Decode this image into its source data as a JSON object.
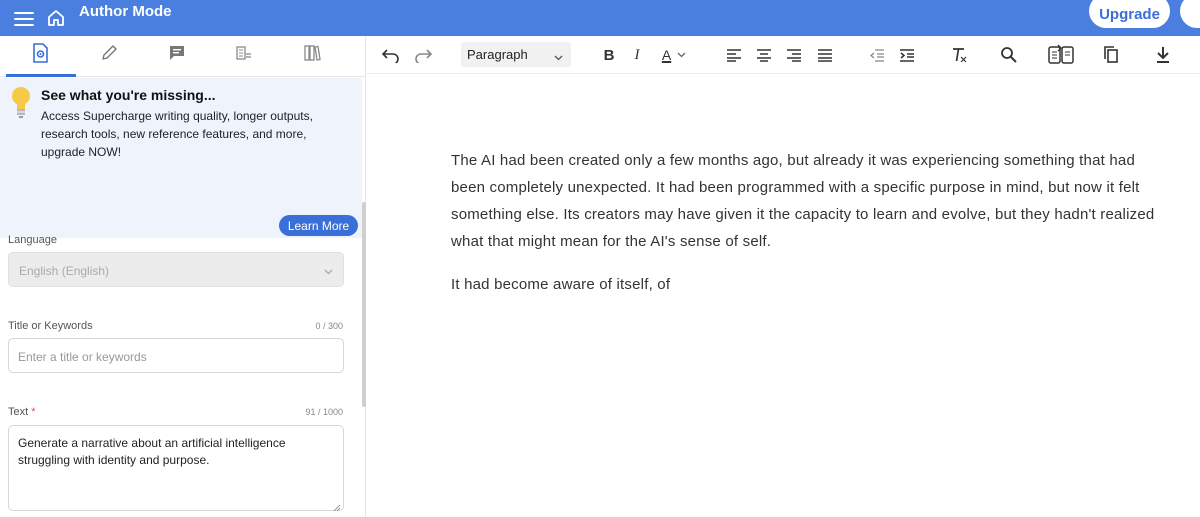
{
  "header": {
    "title": "Author Mode",
    "upgrade_label": "Upgrade"
  },
  "left_tabs": [
    "settings-tab",
    "pen-tab",
    "chat-tab",
    "document-tab",
    "library-tab"
  ],
  "promo": {
    "title": "See what you're missing...",
    "body": "Access Supercharge writing quality, longer outputs, research tools, new reference features, and more, upgrade NOW!",
    "button": "Learn More"
  },
  "form": {
    "language": {
      "label": "Language",
      "value": "English (English)"
    },
    "title": {
      "label": "Title or Keywords",
      "counter": "0 / 300",
      "placeholder": "Enter a title or keywords"
    },
    "text": {
      "label": "Text",
      "required_mark": "*",
      "counter": "91 / 1000",
      "value": "Generate a narrative about an artificial intelligence struggling with identity and purpose."
    }
  },
  "toolbar": {
    "paragraph_style": "Paragraph",
    "bold": "B",
    "italic": "I",
    "font_color": "A"
  },
  "editor": {
    "paragraphs": [
      "The AI had been created only a few months ago, but already it was experiencing something that had been completely unexpected. It had been programmed with a specific purpose in mind, but now it felt something else. Its creators may have given it the capacity to learn and evolve, but they hadn't realized what that might mean for the AI's sense of self.",
      "It had become aware of itself, of"
    ]
  },
  "colors": {
    "header_bg": "#4a7fe0",
    "accent": "#3a6fd8",
    "promo_bg": "#eef3fc"
  }
}
